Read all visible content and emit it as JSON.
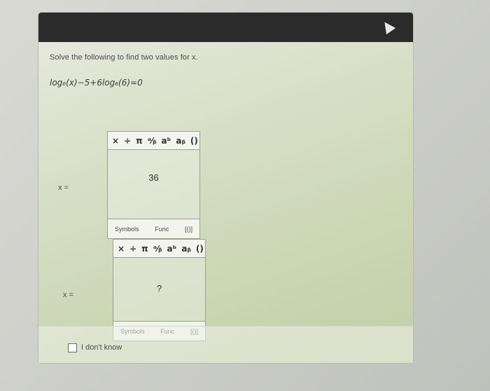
{
  "question": {
    "prompt": "Solve the following to find two values for x.",
    "equation": "log₆(x)−5+6log₆(6)=0"
  },
  "toolbar": {
    "times": "×",
    "divide": "÷",
    "pi": "π",
    "fraction": "ᵃ⁄ᵦ",
    "power": "aᵇ",
    "subscript": "aᵦ",
    "parens": "()"
  },
  "answers": [
    {
      "label": "x =",
      "value": "36"
    },
    {
      "label": "x =",
      "value": "?"
    }
  ],
  "tabs": {
    "symbols": "Symbols",
    "func": "Func",
    "braces": "[()]"
  },
  "footer": {
    "dont_know": "I don't know"
  }
}
